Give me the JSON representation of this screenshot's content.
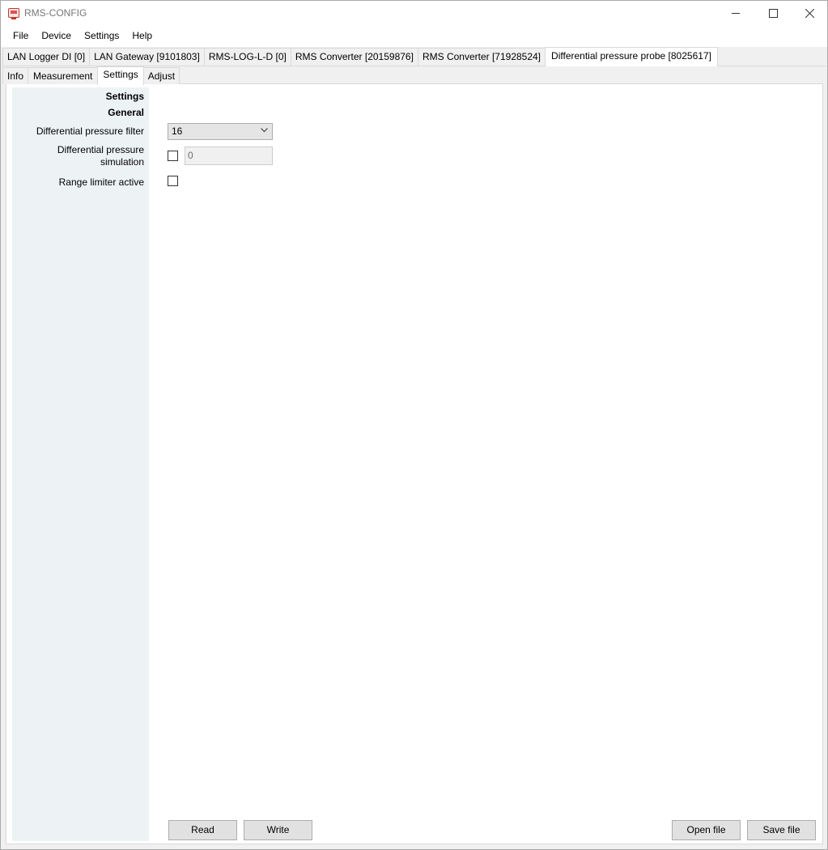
{
  "window": {
    "title": "RMS-CONFIG"
  },
  "menu": [
    "File",
    "Device",
    "Settings",
    "Help"
  ],
  "device_tabs": [
    "LAN Logger DI [0]",
    "LAN Gateway [9101803]",
    "RMS-LOG-L-D [0]",
    "RMS Converter [20159876]",
    "RMS Converter [71928524]",
    "Differential pressure probe [8025617]"
  ],
  "sub_tabs": [
    "Info",
    "Measurement",
    "Settings",
    "Adjust"
  ],
  "form": {
    "section_title": "Settings",
    "group_title": "General",
    "filter_label": "Differential pressure filter",
    "filter_value": "16",
    "simulation_label_line1": "Differential pressure",
    "simulation_label_line2": "simulation",
    "simulation_value": "0",
    "range_label": "Range limiter active"
  },
  "buttons": {
    "read": "Read",
    "write": "Write",
    "open_file": "Open file",
    "save_file": "Save file"
  }
}
